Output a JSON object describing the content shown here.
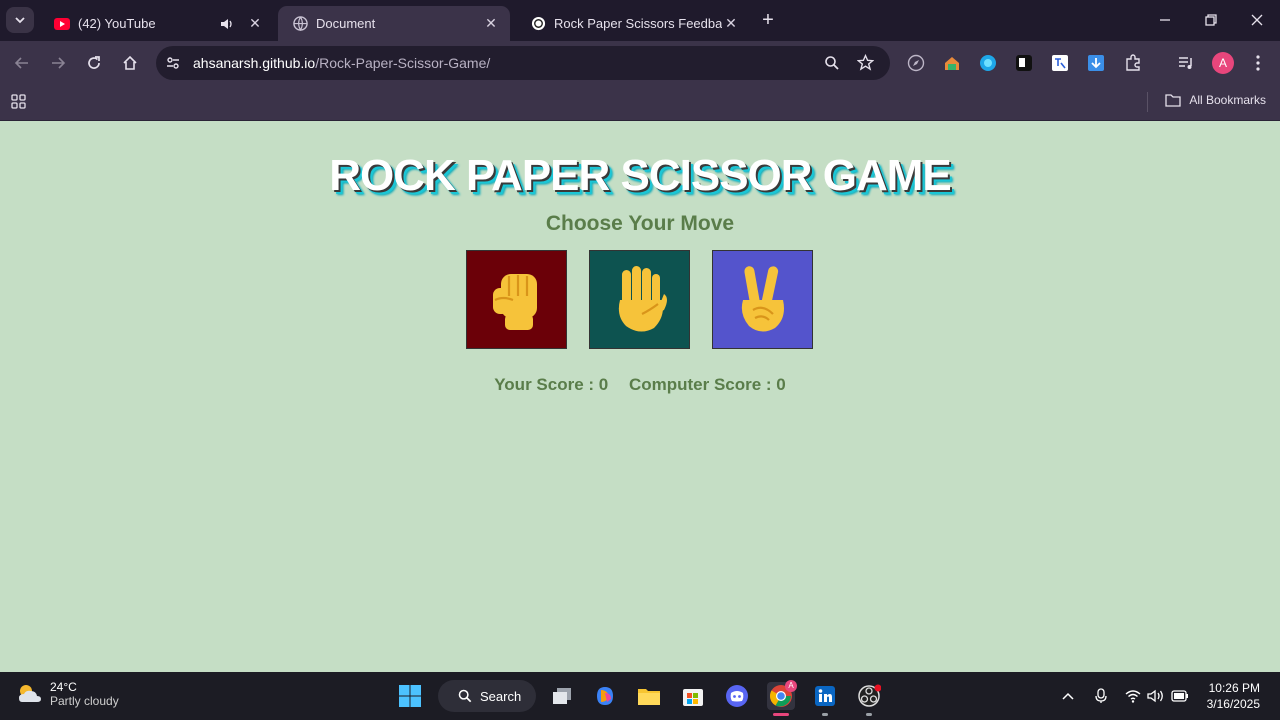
{
  "browser": {
    "tabs": [
      {
        "title": "(42) YouTube",
        "favicon": "youtube-icon",
        "active": false,
        "audio": true
      },
      {
        "title": "Document",
        "favicon": "globe-icon",
        "active": true
      },
      {
        "title": "Rock Paper Scissors Feedback",
        "favicon": "openai-icon",
        "active": false
      }
    ],
    "url_domain": "ahsanarsh.github.io",
    "url_path": "/Rock-Paper-Scissor-Game/",
    "profile_initial": "A",
    "bookmarks_label": "All Bookmarks"
  },
  "game": {
    "title": "ROCK PAPER SCISSOR GAME",
    "subtitle": "Choose Your Move",
    "choices": [
      {
        "name": "rock",
        "icon": "raised-fist-icon",
        "bg": "#6b0008"
      },
      {
        "name": "paper",
        "icon": "raised-hand-icon",
        "bg": "#0d5350"
      },
      {
        "name": "scissors",
        "icon": "victory-hand-icon",
        "bg": "#5454cc"
      }
    ],
    "your_score": "Your Score : 0",
    "computer_score": "Computer Score : 0"
  },
  "taskbar": {
    "temperature": "24°C",
    "weather": "Partly cloudy",
    "search_label": "Search",
    "time": "10:26 PM",
    "date": "3/16/2025"
  },
  "colors": {
    "page_bg": "#c5dec5",
    "subtitle_text": "#5a7d4a",
    "title_shadow": "#1bc6d6"
  }
}
